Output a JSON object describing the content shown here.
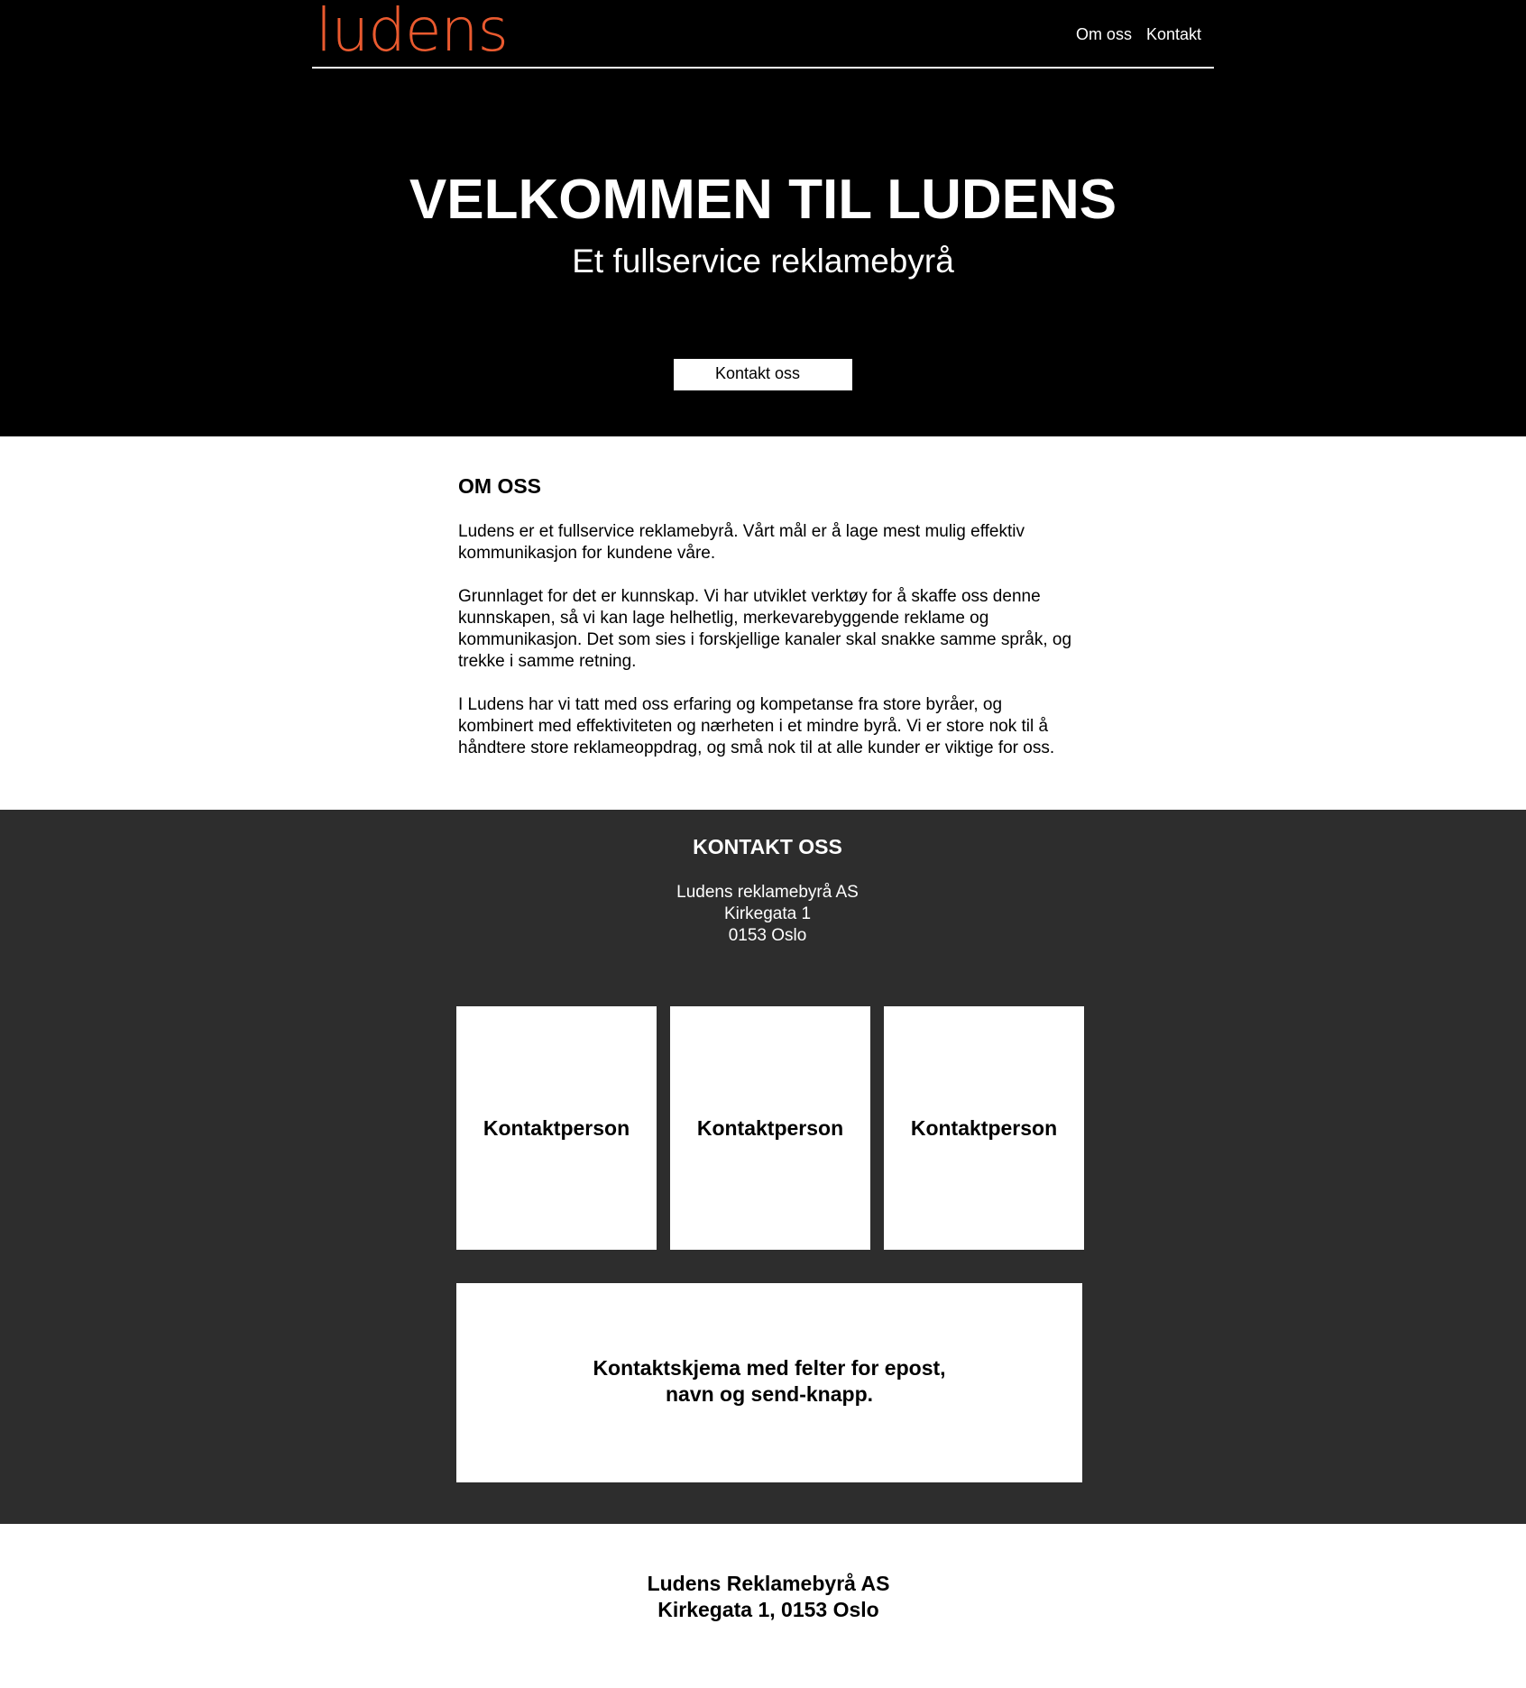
{
  "header": {
    "logo": "ludens",
    "nav": [
      "Om oss",
      "Kontakt"
    ]
  },
  "hero": {
    "title": "VELKOMMEN TIL LUDENS",
    "subtitle": "Et fullservice reklamebyrå",
    "cta_label": "Kontakt oss"
  },
  "about": {
    "heading": "OM OSS",
    "paragraphs": [
      "Ludens er et fullservice reklamebyrå. Vårt mål er å lage mest mulig effektiv kommunikasjon for kundene våre.",
      "Grunnlaget for det er kunnskap. Vi har utviklet verktøy for å skaffe oss denne kunnskapen, så vi kan lage helhetlig, merkevarebyggende reklame og kommunikasjon. Det som sies i forskjellige kanaler skal snakke samme språk, og trekke i samme retning.",
      "I Ludens har vi tatt med oss erfaring og kompetanse fra store byråer, og kombinert med effektiviteten og nærheten i et mindre byrå. Vi er store nok til å håndtere store reklameoppdrag, og små nok til at alle kunder er viktige for oss."
    ]
  },
  "contact": {
    "heading": "KONTAKT OSS",
    "address": [
      "Ludens reklamebyrå AS",
      "Kirkegata 1",
      "0153 Oslo"
    ],
    "cards": [
      "Kontaktperson",
      "Kontaktperson",
      "Kontaktperson"
    ],
    "form_placeholder": "Kontaktskjema med felter for epost, navn og send-knapp."
  },
  "footer": {
    "lines": [
      "Ludens Reklamebyrå AS",
      "Kirkegata 1, 0153 Oslo"
    ]
  },
  "colors": {
    "brand_orange": "#ea5a2f",
    "hero_bg": "#000000",
    "contact_bg": "#2d2d2d"
  }
}
